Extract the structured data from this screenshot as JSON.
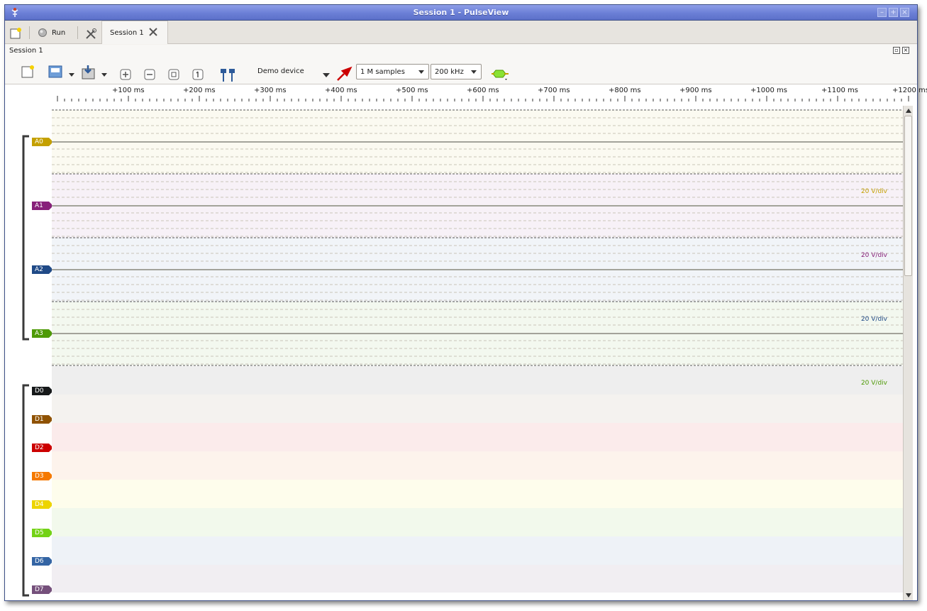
{
  "window": {
    "title": "Session 1 - PulseView"
  },
  "main_toolbar": {
    "run_label": "Run",
    "tab_label": "Session 1"
  },
  "session": {
    "header_label": "Session 1",
    "device": "Demo device",
    "samples": "1 M samples",
    "rate": "200 kHz"
  },
  "ruler": {
    "ticks": [
      "+100 ms",
      "+200 ms",
      "+300 ms",
      "+400 ms",
      "+500 ms",
      "+600 ms",
      "+700 ms",
      "+800 ms",
      "+900 ms",
      "+1000 ms",
      "+1100 ms",
      "+1200 ms"
    ]
  },
  "analog_channels": [
    {
      "name": "A0",
      "color": "#c4a000",
      "bg": "#fbfaf1",
      "scale": "20 V/div"
    },
    {
      "name": "A1",
      "color": "#87207a",
      "bg": "#f7f1f7",
      "scale": "20 V/div"
    },
    {
      "name": "A2",
      "color": "#204a87",
      "bg": "#f1f4f8",
      "scale": "20 V/div"
    },
    {
      "name": "A3",
      "color": "#4e9a06",
      "bg": "#f3f8ef",
      "scale": "20 V/div"
    }
  ],
  "digital_channels": [
    {
      "name": "D0",
      "color": "#16191a",
      "bg": "#eeeeee"
    },
    {
      "name": "D1",
      "color": "#8f5202",
      "bg": "#f4f2ef"
    },
    {
      "name": "D2",
      "color": "#cc0000",
      "bg": "#fbebeb"
    },
    {
      "name": "D3",
      "color": "#f57900",
      "bg": "#fdf3ec"
    },
    {
      "name": "D4",
      "color": "#edd400",
      "bg": "#fefdec"
    },
    {
      "name": "D5",
      "color": "#73d216",
      "bg": "#f2f9ec"
    },
    {
      "name": "D6",
      "color": "#3465a4",
      "bg": "#eef2f7"
    },
    {
      "name": "D7",
      "color": "#75507b",
      "bg": "#f1eef2"
    }
  ]
}
